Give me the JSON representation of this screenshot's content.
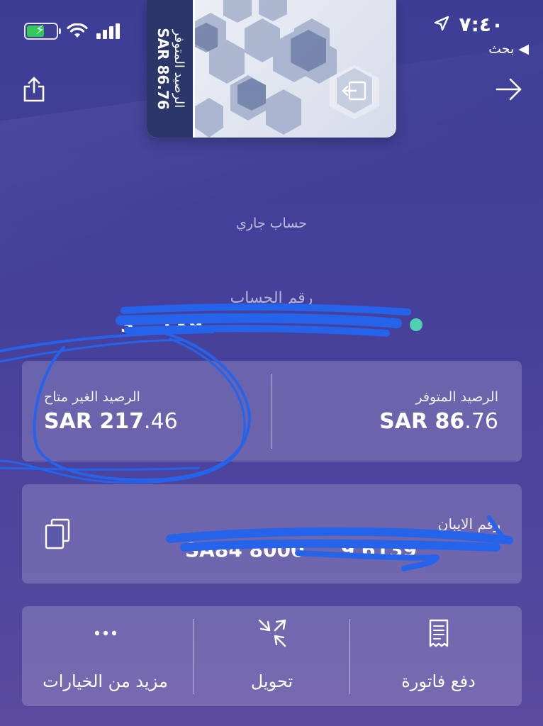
{
  "status_bar": {
    "time": "٧:٤٠",
    "back_label": "◀ بحث"
  },
  "card": {
    "label": "الرصيد المتوفر",
    "amount": "SAR 86.76"
  },
  "account": {
    "type": "حساب جاري",
    "number_label": "رقم الحساب",
    "number_visible": "3...139"
  },
  "balances": {
    "available_label": "الرصيد المتوفر",
    "available_currency": "SAR 86",
    "available_decimal": ".76",
    "unavailable_label": "الرصيد الغير متاح",
    "unavailable_currency": "SAR 217",
    "unavailable_decimal": ".46"
  },
  "iban": {
    "label": "رقم الايبان",
    "value_visible": "SA84 8000 ... 9 6139"
  },
  "actions": [
    {
      "label": "مزيد من الخيارات",
      "icon": "more-icon"
    },
    {
      "label": "تحويل",
      "icon": "transfer-icon"
    },
    {
      "label": "دفع فاتورة",
      "icon": "bill-icon"
    }
  ],
  "colors": {
    "background": "#46409a",
    "panel": "rgba(255,255,255,0.18)",
    "status_dot": "#4fd1b0",
    "scribble": "#2563eb",
    "battery": "#34c759"
  }
}
